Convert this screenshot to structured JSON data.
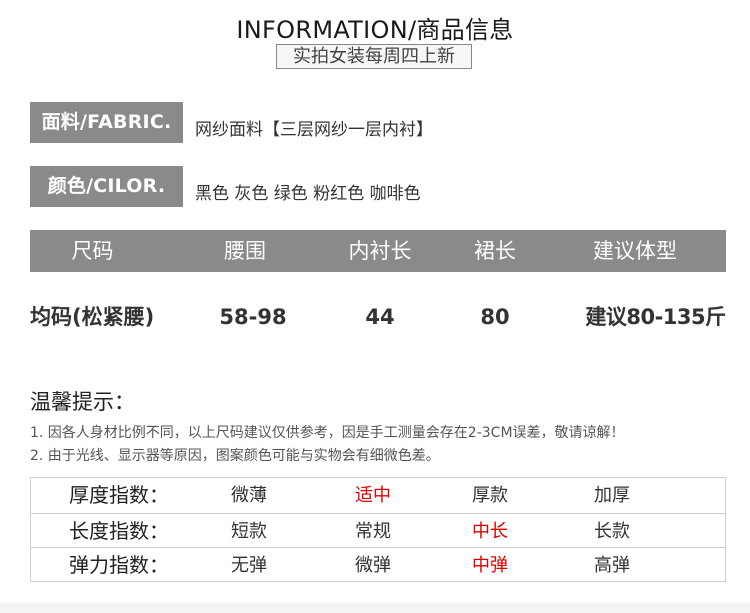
{
  "header": {
    "title": "INFORMATION/商品信息",
    "subtitle": "实拍女装每周四上新"
  },
  "attributes": [
    {
      "label": "面料/FABRIC.",
      "value": "网纱面料【三层网纱一层内衬】"
    },
    {
      "label": "颜色/CILOR.",
      "value": "黑色 灰色 绿色 粉红色  咖啡色"
    }
  ],
  "size_table": {
    "headers": [
      "尺码",
      "腰围",
      "内衬长",
      "裙长",
      "建议体型"
    ],
    "rows": [
      [
        "均码(松紧腰)",
        "58-98",
        "44",
        "80",
        "建议80-135斤"
      ]
    ]
  },
  "tips": {
    "title": "温馨提示：",
    "items": [
      "1. 因各人身材比例不同，以上尺码建议仅供参考，因是手工测量会存在2-3CM误差，敬请谅解！",
      "2.  由于光线、显示器等原因，图案颜色可能与实物会有细微色差。"
    ]
  },
  "index_table": [
    {
      "label": "厚度指数：",
      "options": [
        "微薄",
        "适中",
        "厚款",
        "加厚"
      ],
      "active": 1
    },
    {
      "label": "长度指数：",
      "options": [
        "短款",
        "常规",
        "中长",
        "长款"
      ],
      "active": 2
    },
    {
      "label": "弹力指数：",
      "options": [
        "无弹",
        "微弹",
        "中弹",
        "高弹"
      ],
      "active": 2
    }
  ],
  "colors": {
    "tag_bg": "#8a8a8a",
    "active_option": "#e00000"
  }
}
